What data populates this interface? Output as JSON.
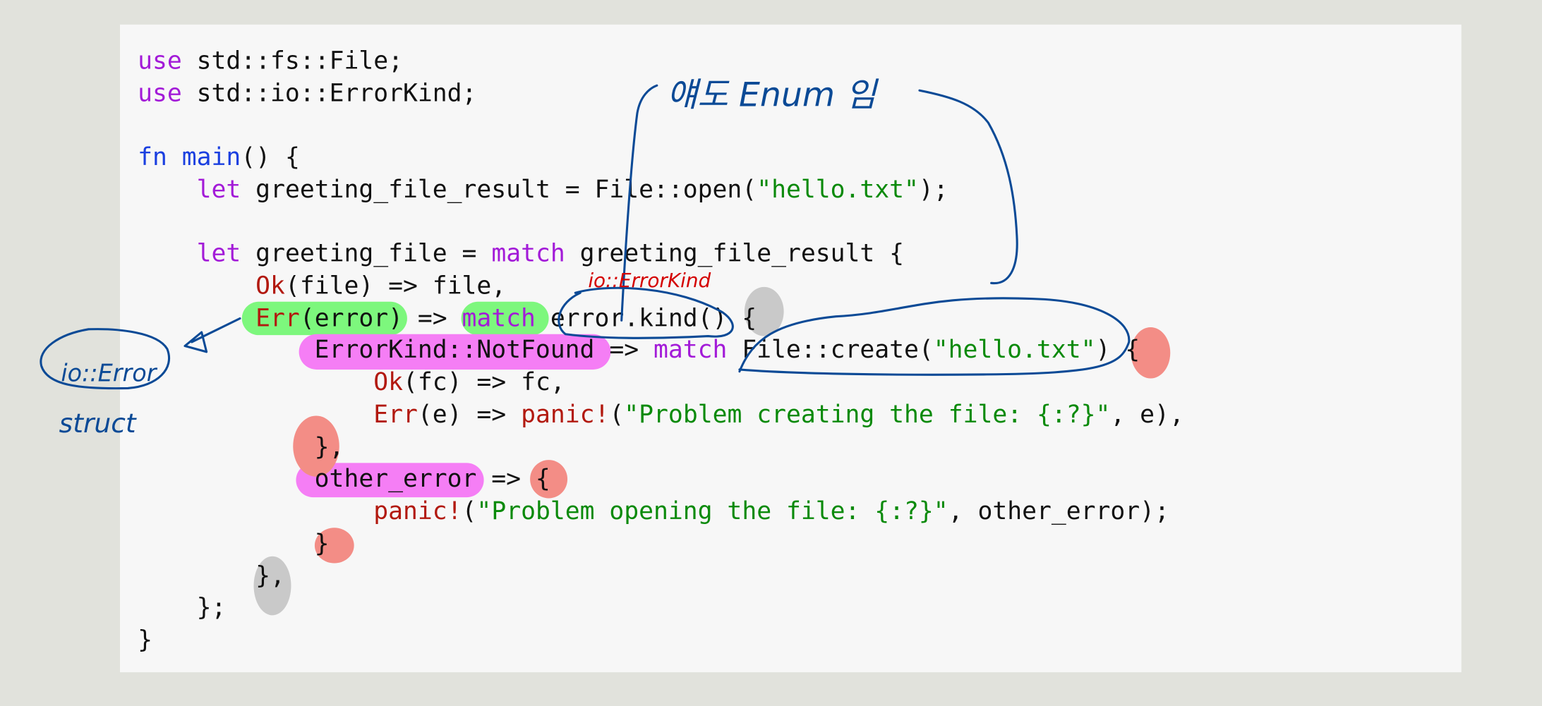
{
  "code": {
    "lines": [
      [
        [
          "use",
          "kw"
        ],
        [
          " std::fs::File;",
          "pl"
        ]
      ],
      [
        [
          "use",
          "kw"
        ],
        [
          " std::io::ErrorKind;",
          "pl"
        ]
      ],
      [],
      [
        [
          "fn",
          "fn"
        ],
        [
          " ",
          "pl"
        ],
        [
          "main",
          "fn"
        ],
        [
          "() {",
          "pl"
        ]
      ],
      [
        [
          "    ",
          "pl"
        ],
        [
          "let",
          "kw"
        ],
        [
          " greeting_file_result = File::open(",
          "pl"
        ],
        [
          "\"hello.txt\"",
          "st"
        ],
        [
          ");",
          "pl"
        ]
      ],
      [],
      [
        [
          "    ",
          "pl"
        ],
        [
          "let",
          "kw"
        ],
        [
          " greeting_file = ",
          "pl"
        ],
        [
          "match",
          "kw"
        ],
        [
          " greeting_file_result {",
          "pl"
        ]
      ],
      [
        [
          "        ",
          "pl"
        ],
        [
          "Ok",
          "en"
        ],
        [
          "(file) => file,",
          "pl"
        ]
      ],
      [
        [
          "        ",
          "pl"
        ],
        [
          "Err",
          "en"
        ],
        [
          "(error) => ",
          "pl"
        ],
        [
          "match",
          "kw"
        ],
        [
          " error.kind() {",
          "pl"
        ]
      ],
      [
        [
          "            ErrorKind::NotFound => ",
          "pl"
        ],
        [
          "match",
          "kw"
        ],
        [
          " File::create(",
          "pl"
        ],
        [
          "\"hello.txt\"",
          "st"
        ],
        [
          ") {",
          "pl"
        ]
      ],
      [
        [
          "                ",
          "pl"
        ],
        [
          "Ok",
          "en"
        ],
        [
          "(fc) => fc,",
          "pl"
        ]
      ],
      [
        [
          "                ",
          "pl"
        ],
        [
          "Err",
          "en"
        ],
        [
          "(e) => ",
          "pl"
        ],
        [
          "panic!",
          "en"
        ],
        [
          "(",
          "pl"
        ],
        [
          "\"Problem creating the file: {:?}\"",
          "st"
        ],
        [
          ", e),",
          "pl"
        ]
      ],
      [
        [
          "            },",
          "pl"
        ]
      ],
      [
        [
          "            other_error => {",
          "pl"
        ]
      ],
      [
        [
          "                ",
          "pl"
        ],
        [
          "panic!",
          "en"
        ],
        [
          "(",
          "pl"
        ],
        [
          "\"Problem opening the file: {:?}\"",
          "st"
        ],
        [
          ", other_error);",
          "pl"
        ]
      ],
      [
        [
          "            }",
          "pl"
        ]
      ],
      [
        [
          "        },",
          "pl"
        ]
      ],
      [
        [
          "    };",
          "pl"
        ]
      ],
      [
        [
          "}",
          "pl"
        ]
      ]
    ]
  },
  "annotations": {
    "enum_note": "얘도 Enum 임",
    "error_kind_note": "io::ErrorKind",
    "error_note": "io::Error",
    "struct_note": "struct"
  },
  "colors": {
    "keyword": "#a31bd8",
    "fn": "#1a3fe0",
    "enum_variant": "#b2190f",
    "string": "#0a8a0a",
    "ink_blue": "#0b4a96",
    "ink_red": "#d40000",
    "highlight_green": "#7df77d",
    "highlight_magenta": "#f57ef5",
    "highlight_salmon": "#f38d86",
    "highlight_gray": "#c9c9c9"
  }
}
